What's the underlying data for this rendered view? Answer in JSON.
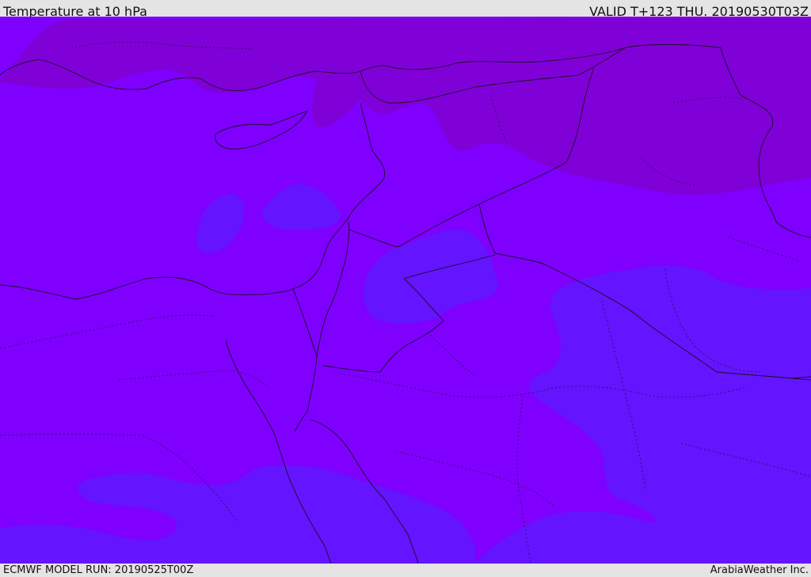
{
  "header": {
    "title": "Temperature at 10 hPa",
    "valid": "VALID T+123 THU. 20190530T03Z"
  },
  "footer": {
    "model_run": "ECMWF MODEL RUN: 20190525T00Z",
    "credit": "ArabiaWeather Inc."
  },
  "map": {
    "variable": "Temperature",
    "level": "10 hPa",
    "colors": {
      "base": "#7f00ff",
      "cold": "#8000d8",
      "warm": "#6414ff",
      "land_outline": "#1a1020"
    }
  }
}
